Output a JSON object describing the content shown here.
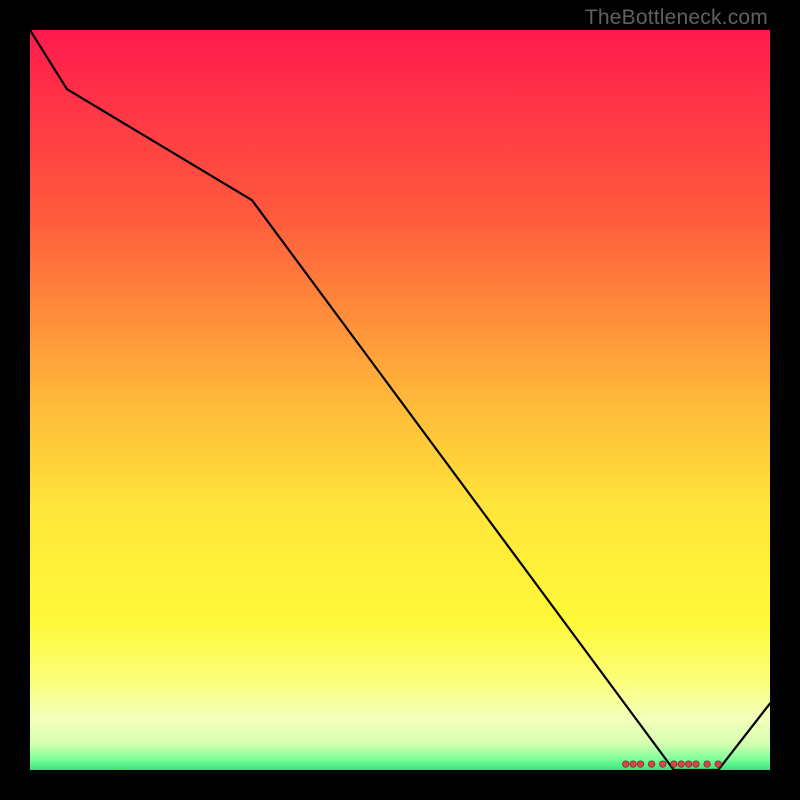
{
  "watermark": "TheBottleneck.com",
  "chart_data": {
    "type": "line",
    "title": "",
    "xlabel": "",
    "ylabel": "",
    "xlim": [
      0,
      100
    ],
    "ylim": [
      0,
      100
    ],
    "gradient": {
      "stops": [
        {
          "offset": 0,
          "color": "#ff1a4d"
        },
        {
          "offset": 0.25,
          "color": "#ff5a3c"
        },
        {
          "offset": 0.5,
          "color": "#ffb83a"
        },
        {
          "offset": 0.65,
          "color": "#ffe63a"
        },
        {
          "offset": 0.8,
          "color": "#fff93a"
        },
        {
          "offset": 0.88,
          "color": "#fbff7a"
        },
        {
          "offset": 0.93,
          "color": "#f4ffba"
        },
        {
          "offset": 0.965,
          "color": "#d4ffb0"
        },
        {
          "offset": 0.985,
          "color": "#7eff9a"
        },
        {
          "offset": 1.0,
          "color": "#34e37a"
        }
      ]
    },
    "series": [
      {
        "name": "line",
        "x": [
          0,
          5,
          30,
          87,
          93,
          100
        ],
        "y": [
          100,
          92,
          77,
          0,
          0,
          9
        ]
      }
    ],
    "markers": {
      "x": [
        80.5,
        81.5,
        82.5,
        84,
        85.5,
        87,
        88,
        89,
        90,
        91.5,
        93
      ],
      "y": [
        0.8,
        0.8,
        0.8,
        0.8,
        0.8,
        0.8,
        0.8,
        0.8,
        0.8,
        0.8,
        0.8
      ]
    }
  }
}
